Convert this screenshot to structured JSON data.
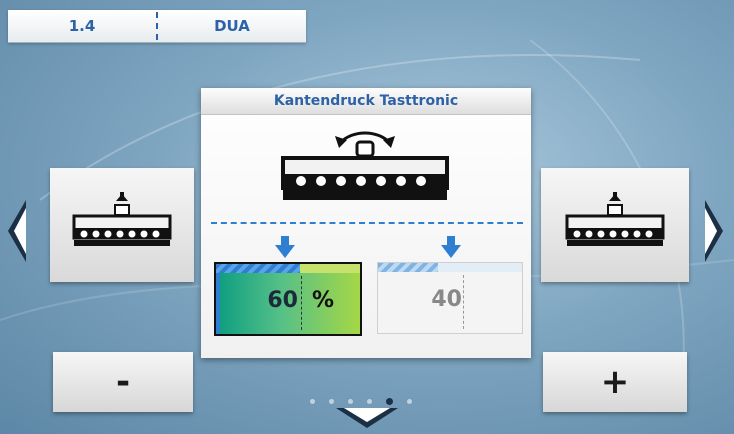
{
  "header": {
    "left_value": "1.4",
    "right_value": "DUA"
  },
  "panel": {
    "title": "Kantendruck Tasttronic",
    "active_box": {
      "value": "60",
      "unit": "%",
      "bar_fill_fraction": 0.58
    },
    "inactive_box": {
      "value": "40",
      "bar_fill_fraction": 0.42
    }
  },
  "buttons": {
    "minus_label": "-",
    "plus_label": "+"
  },
  "pager": {
    "page_count": 6,
    "active_index": 4
  },
  "colors": {
    "accent": "#2e62a6",
    "arrow_blue": "#2e7fd2",
    "background": "#7fa6c1"
  }
}
